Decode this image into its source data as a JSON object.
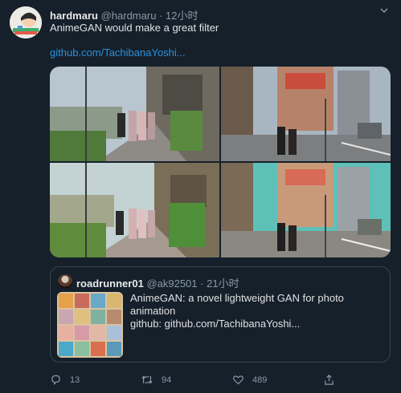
{
  "tweet": {
    "author_name": "hardmaru",
    "author_handle": "@hardmaru",
    "separator": "·",
    "time": "12小时",
    "text": "AnimeGAN would make a great filter",
    "link": "github.com/TachibanaYoshi..."
  },
  "quoted": {
    "author_name": "roadrunner01",
    "author_handle": "@ak92501",
    "separator": "·",
    "time": "21小时",
    "line1": "AnimeGAN: a novel lightweight GAN for photo",
    "line2": "animation",
    "line3": "github: github.com/TachibanaYoshi..."
  },
  "actions": {
    "replies": "13",
    "retweets": "94",
    "likes": "489"
  },
  "icons": {
    "menu": "chevron-down-icon",
    "reply": "reply-icon",
    "retweet": "retweet-icon",
    "like": "heart-icon",
    "share": "share-icon"
  },
  "colors": {
    "background": "#15202b",
    "link": "#2f8fdb",
    "muted": "#8899a6",
    "border": "#38444d"
  }
}
